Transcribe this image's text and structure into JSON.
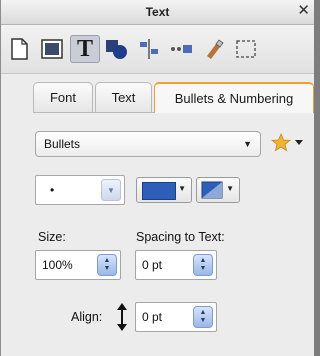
{
  "window": {
    "title": "Text",
    "close_glyph": "✕"
  },
  "toolbar": {
    "tools": [
      {
        "icon": "document-icon"
      },
      {
        "icon": "fill-icon"
      },
      {
        "icon": "text-icon",
        "glyph": "T",
        "selected": true
      },
      {
        "icon": "shapes-icon"
      },
      {
        "icon": "align-icon"
      },
      {
        "icon": "connector-icon"
      },
      {
        "icon": "brush-icon"
      },
      {
        "icon": "selection-icon"
      }
    ]
  },
  "tabs": [
    {
      "label": "Font",
      "active": false
    },
    {
      "label": "Text",
      "active": false
    },
    {
      "label": "Bullets & Numbering",
      "active": true
    }
  ],
  "bullets": {
    "type_value": "Bullets",
    "bullet_char": "•",
    "bullet_color": "#2e5fb8",
    "size_label": "Size:",
    "size_value": "100%",
    "spacing_label": "Spacing to Text:",
    "spacing_value": "0 pt",
    "align_label": "Align:",
    "align_value": "0 pt"
  },
  "colors": {
    "accent_tab": "#f0a030",
    "star": "#f2b233"
  }
}
